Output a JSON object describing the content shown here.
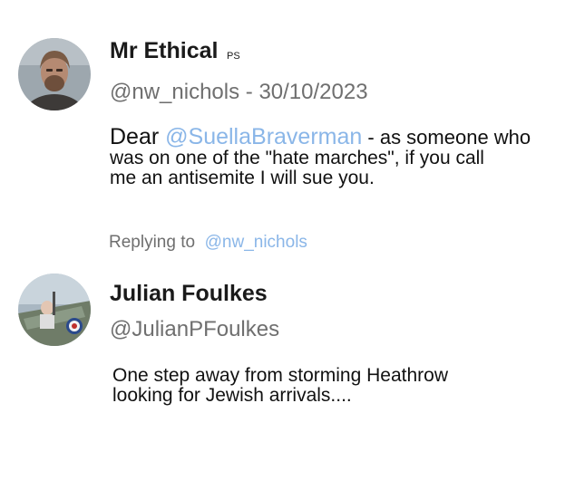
{
  "tweet1": {
    "author_name": "Mr Ethical",
    "author_badge": "PS",
    "handle": "@nw_nichols",
    "separator": " - ",
    "date": "30/10/2023",
    "text_prefix": "Dear ",
    "text_mention": "@SuellaBraverman",
    "text_rest_line1": " - as someone who",
    "text_line2": "was on one of the \"hate marches\", if you call",
    "text_line3": "me an antisemite I will sue you.",
    "avatar_icon": "person-portrait-icon"
  },
  "reply_context": {
    "label": "Replying to",
    "mention": "@nw_nichols"
  },
  "tweet2": {
    "author_name": "Julian Foulkes",
    "handle": "@JulianPFoulkes",
    "text_line1": "One step away from storming Heathrow",
    "text_line2": "looking for Jewish arrivals....",
    "avatar_icon": "aircraft-cockpit-photo-icon"
  },
  "colors": {
    "mention": "#8ab6e8",
    "handle": "#6f6f6f",
    "text": "#111111"
  }
}
